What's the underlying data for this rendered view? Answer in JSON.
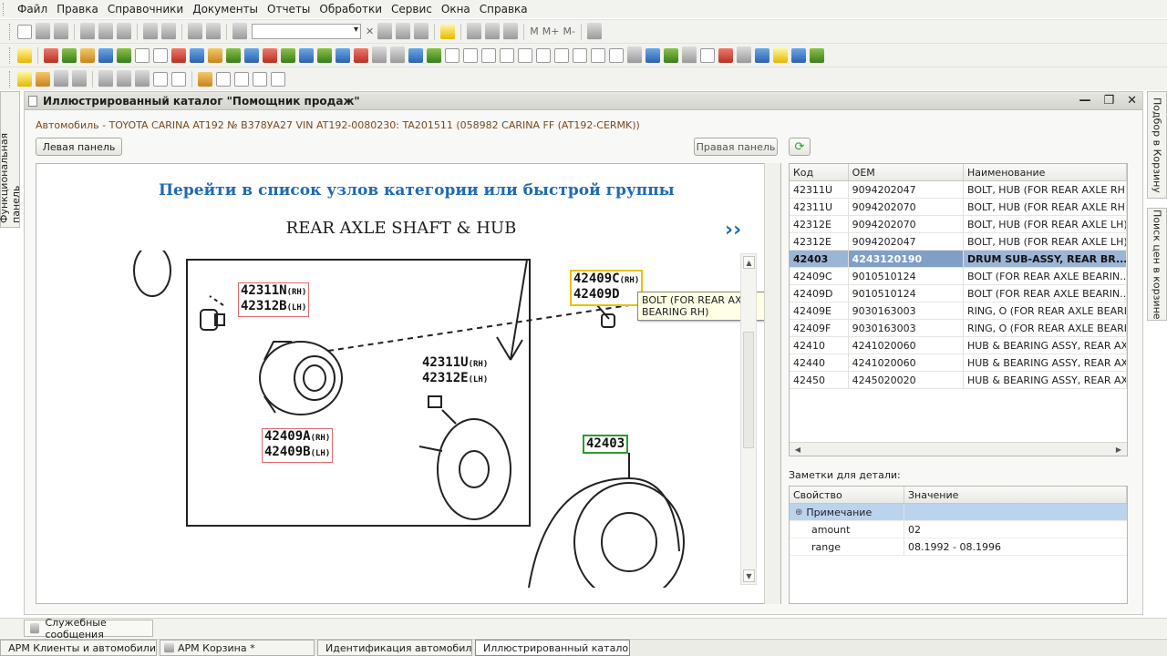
{
  "menu": [
    "Файл",
    "Правка",
    "Справочники",
    "Документы",
    "Отчеты",
    "Обработки",
    "Сервис",
    "Окна",
    "Справка"
  ],
  "toolbar": {
    "memory_labels": [
      "M",
      "M+",
      "M-"
    ]
  },
  "side_panels": {
    "left": "Функциональная панель",
    "right_top": "Подбор в Корзину",
    "right_bottom": "Поиск цен в корзине"
  },
  "window": {
    "title": "Иллюстрированный каталог \"Помощник продаж\"",
    "car_info": "Автомобиль - TOYOTA CARINA AT192 № В378УА27 VIN AT192-0080230:     TA201511 (058982 CARINA FF (AT192-CERMK))",
    "left_panel_button": "Левая панель",
    "right_panel_button": "Правая панель",
    "refresh_icon": "refresh-icon"
  },
  "diagram": {
    "link_text": "Перейти в список узлов категории или быстрой группы",
    "title": "REAR AXLE SHAFT & HUB",
    "next_symbol": "››",
    "callouts": [
      {
        "line1": "42311N",
        "s1": "(RH)",
        "line2": "42312B",
        "s2": "(LH)"
      },
      {
        "line1": "42311U",
        "s1": "(RH)",
        "line2": "42312E",
        "s2": "(LH)"
      },
      {
        "line1": "42409A",
        "s1": "(RH)",
        "line2": "42409B",
        "s2": "(LH)"
      },
      {
        "line1": "42409C",
        "s1": "(RH)",
        "line2": "42409D",
        "s2": ""
      },
      {
        "line1": "42403",
        "s1": "",
        "line2": "",
        "s2": ""
      }
    ],
    "tooltip": "BOLT (FOR REAR AXLE BEARING RH)"
  },
  "parts_table": {
    "headers": [
      "Код",
      "OEM",
      "Наименование"
    ],
    "rows": [
      {
        "code": "42311U",
        "oem": "9094202047",
        "name": "BOLT, HUB (FOR REAR AXLE RH)"
      },
      {
        "code": "42311U",
        "oem": "9094202070",
        "name": "BOLT, HUB (FOR REAR AXLE RH)"
      },
      {
        "code": "42312E",
        "oem": "9094202070",
        "name": "BOLT, HUB (FOR REAR AXLE LH)"
      },
      {
        "code": "42312E",
        "oem": "9094202047",
        "name": "BOLT, HUB (FOR REAR AXLE LH)"
      },
      {
        "code": "42403",
        "oem": "4243120190",
        "name": "DRUM SUB-ASSY, REAR BR..."
      },
      {
        "code": "42409C",
        "oem": "9010510124",
        "name": "BOLT (FOR REAR AXLE BEARIN..."
      },
      {
        "code": "42409D",
        "oem": "9010510124",
        "name": "BOLT (FOR REAR AXLE BEARIN..."
      },
      {
        "code": "42409E",
        "oem": "9030163003",
        "name": "RING, O (FOR REAR AXLE BEARI..."
      },
      {
        "code": "42409F",
        "oem": "9030163003",
        "name": "RING, O (FOR REAR AXLE BEARI..."
      },
      {
        "code": "42410",
        "oem": "4241020060",
        "name": "HUB & BEARING ASSY, REAR AX..."
      },
      {
        "code": "42440",
        "oem": "4241020060",
        "name": "HUB & BEARING ASSY, REAR AX..."
      },
      {
        "code": "42450",
        "oem": "4245020020",
        "name": "HUB & BEARING ASSY, REAR AX..."
      }
    ]
  },
  "notes": {
    "label": "Заметки для детали:",
    "headers": [
      "Свойство",
      "Значение"
    ],
    "group": "Примечание",
    "rows": [
      {
        "prop": "amount",
        "value": "02"
      },
      {
        "prop": "range",
        "value": "08.1992 - 08.1996"
      }
    ]
  },
  "status": {
    "messages_tab": "Служебные сообщения"
  },
  "taskbar": [
    {
      "label": "АРМ Клиенты и автомобили"
    },
    {
      "label": "АРМ Корзина *"
    },
    {
      "label": "Идентификация автомобил..."
    },
    {
      "label": "Иллюстрированный катало..."
    }
  ],
  "colors": {
    "selected_row": "#9ab5d6",
    "link": "#1f6ab3",
    "callout_red": "#e06a6a",
    "callout_yellow": "#e6c200",
    "callout_green": "#2e9b2e"
  }
}
